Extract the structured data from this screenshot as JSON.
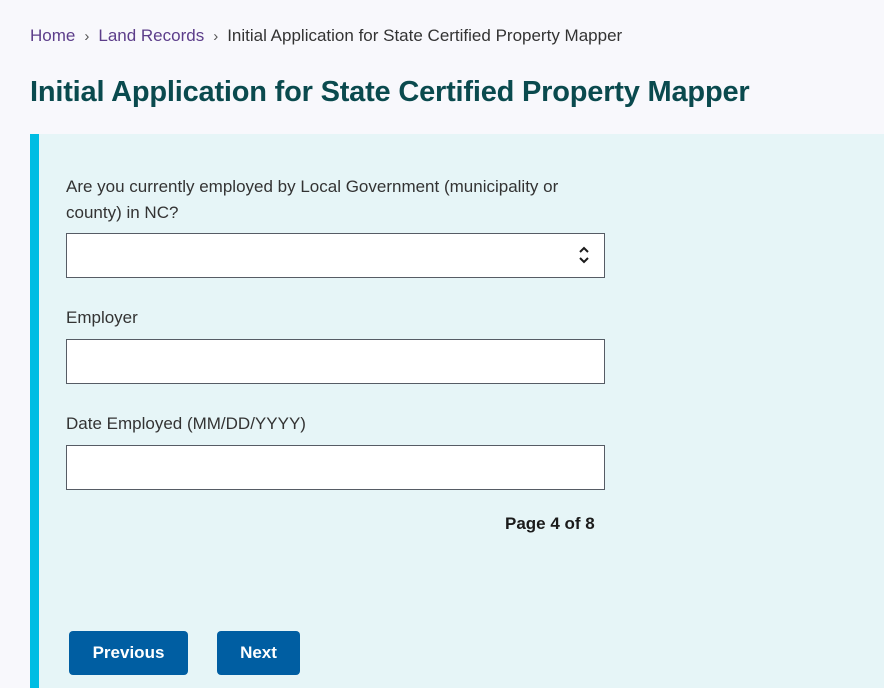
{
  "breadcrumb": {
    "items": [
      {
        "label": "Home",
        "link": true
      },
      {
        "label": "Land Records",
        "link": true
      },
      {
        "label": "Initial Application for State Certified Property Mapper",
        "link": false
      }
    ],
    "separator": "›"
  },
  "page_title": "Initial Application for State Certified Property Mapper",
  "form": {
    "employed_question": {
      "label": "Are you currently employed by Local Government (municipality or county) in NC?",
      "value": ""
    },
    "employer": {
      "label": "Employer",
      "value": ""
    },
    "date_employed": {
      "label": "Date Employed (MM/DD/YYYY)",
      "value": ""
    },
    "page_indicator": "Page 4 of 8",
    "previous_label": "Previous",
    "next_label": "Next"
  },
  "colors": {
    "accent_bar": "#00bde3",
    "panel_bg": "#e6f5f7",
    "button_bg": "#005ea2",
    "title": "#0a4a4e",
    "link": "#5c3d8a"
  }
}
